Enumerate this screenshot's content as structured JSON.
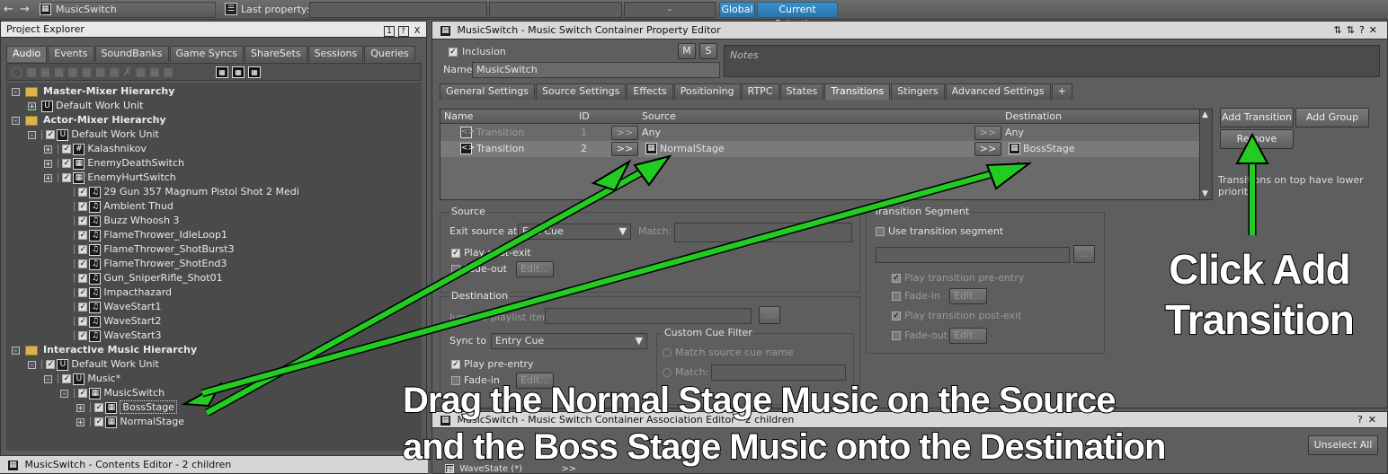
{
  "topbar": {
    "back_icon": "arrow-left-icon",
    "forward_icon": "arrow-right-icon",
    "object_name": "MusicSwitch",
    "last_property_label": "Last property:",
    "dash": "-",
    "global_button": "Global",
    "current_selection_button": "Current Selection"
  },
  "project_explorer": {
    "title": "Project Explorer",
    "title_controls": [
      "1",
      "?",
      "X"
    ],
    "tabs": [
      "Audio",
      "Events",
      "SoundBanks",
      "Game Syncs",
      "ShareSets",
      "Sessions",
      "Queries"
    ],
    "active_tab": "Audio",
    "tree": [
      {
        "label": "Master-Mixer Hierarchy",
        "kind": "folder",
        "bold": true
      },
      {
        "label": "Default Work Unit",
        "kind": "workunit"
      },
      {
        "label": "Actor-Mixer Hierarchy",
        "kind": "folder",
        "bold": true
      },
      {
        "label": "Default Work Unit",
        "kind": "workunit"
      },
      {
        "label": "Kalashnikov",
        "kind": "container"
      },
      {
        "label": "EnemyDeathSwitch",
        "kind": "switch"
      },
      {
        "label": "EnemyHurtSwitch",
        "kind": "switch"
      },
      {
        "label": "29 Gun 357 Magnum Pistol Shot 2 Medi",
        "kind": "sound"
      },
      {
        "label": "Ambient Thud",
        "kind": "sound"
      },
      {
        "label": "Buzz Whoosh 3",
        "kind": "sound"
      },
      {
        "label": "FlameThrower_IdleLoop1",
        "kind": "sound"
      },
      {
        "label": "FlameThrower_ShotBurst3",
        "kind": "sound"
      },
      {
        "label": "FlameThrower_ShotEnd3",
        "kind": "sound"
      },
      {
        "label": "Gun_SniperRifle_Shot01",
        "kind": "sound"
      },
      {
        "label": "Impacthazard",
        "kind": "sound"
      },
      {
        "label": "WaveStart1",
        "kind": "sound"
      },
      {
        "label": "WaveStart2",
        "kind": "sound"
      },
      {
        "label": "WaveStart3",
        "kind": "sound"
      },
      {
        "label": "Interactive Music Hierarchy",
        "kind": "folder",
        "bold": true
      },
      {
        "label": "Default Work Unit",
        "kind": "workunit"
      },
      {
        "label": "Music*",
        "kind": "workunit"
      },
      {
        "label": "MusicSwitch",
        "kind": "switch"
      },
      {
        "label": "BossStage",
        "kind": "playlist"
      },
      {
        "label": "NormalStage",
        "kind": "playlist"
      }
    ]
  },
  "contents_editor": {
    "title": "MusicSwitch - Contents Editor - 2 children"
  },
  "property_editor": {
    "title": "MusicSwitch - Music Switch Container Property Editor",
    "inclusion_label": "Inclusion",
    "m_button": "M",
    "s_button": "S",
    "notes_placeholder": "Notes",
    "name_label": "Name",
    "name_value": "MusicSwitch",
    "tabs": [
      "General Settings",
      "Source Settings",
      "Effects",
      "Positioning",
      "RTPC",
      "States",
      "Transitions",
      "Stingers",
      "Advanced Settings",
      "+"
    ],
    "active_tab": "Transitions",
    "table_headers": {
      "name": "Name",
      "id": "ID",
      "source": "Source",
      "destination": "Destination"
    },
    "rows": [
      {
        "name": "Transition",
        "id": "1",
        "source": "Any",
        "destination": "Any",
        "dim": true
      },
      {
        "name": "Transition",
        "id": "2",
        "source": "NormalStage",
        "destination": "BossStage",
        "dim": false
      }
    ],
    "arrow_button": ">>",
    "add_transition": "Add Transition",
    "add_group": "Add Group",
    "remove": "Remove",
    "priority_note": "Transitions on top have lower priority",
    "source_group": {
      "title": "Source",
      "exit_source_at": "Exit source at",
      "exit_value": "Exit Cue",
      "match_label": "Match:",
      "play_post_exit": "Play post-exit",
      "fade_out": "Fade-out",
      "edit": "Edit..."
    },
    "destination_group": {
      "title": "Destination",
      "jump_to_playlist_item": "Jump to playlist item",
      "sync_to": "Sync to",
      "sync_value": "Entry Cue",
      "play_pre_entry": "Play pre-entry",
      "fade_in": "Fade-in",
      "edit": "Edit...",
      "custom_cue_filter": "Custom Cue Filter",
      "match_source_cue_name": "Match source cue name",
      "match": "Match:"
    },
    "transition_segment": {
      "title": "Transition Segment",
      "use_transition_segment": "Use transition segment",
      "play_transition_pre_entry": "Play transition pre-entry",
      "fade_in": "Fade-in",
      "play_transition_post_exit": "Play transition post-exit",
      "fade_out": "Fade-out",
      "edit": "Edit...",
      "browse": "..."
    }
  },
  "association_editor": {
    "title": "MusicSwitch - Music Switch Container Association Editor - 2 children",
    "unselect_all": "Unselect All",
    "row_label": "WaveState (*)"
  },
  "annotations": {
    "click_add_line1": "Click Add",
    "click_add_line2": "Transition",
    "drag_line1": "Drag the Normal Stage Music on the Source",
    "drag_line2": "and the Boss Stage Music onto the Destination",
    "arrow_color": "#22cc22"
  }
}
